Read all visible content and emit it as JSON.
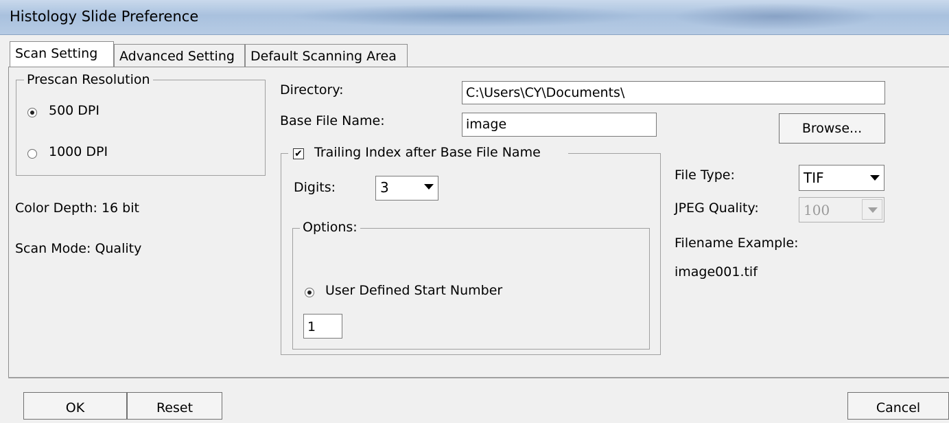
{
  "window": {
    "title": "Histology Slide Preference"
  },
  "tabs": [
    {
      "label": "Scan Setting",
      "active": true
    },
    {
      "label": "Advanced Setting",
      "active": false
    },
    {
      "label": "Default Scanning Area",
      "active": false
    }
  ],
  "prescan": {
    "legend": "Prescan Resolution",
    "options": [
      {
        "label": "500 DPI",
        "selected": true
      },
      {
        "label": "1000 DPI",
        "selected": false
      }
    ]
  },
  "info": {
    "color_depth": "Color Depth: 16 bit",
    "scan_mode": "Scan Mode: Quality"
  },
  "directory": {
    "label": "Directory:",
    "value": "C:\\Users\\CY\\Documents\\"
  },
  "base_file": {
    "label": "Base File Name:",
    "value": "image"
  },
  "browse_label": "Browse...",
  "trailing": {
    "label": "Trailing Index after Base File Name",
    "checked": true,
    "digits_label": "Digits:",
    "digits_value": "3",
    "options_legend": "Options:",
    "user_defined_label": "User Defined Start Number",
    "user_defined_selected": true,
    "start_number": "1"
  },
  "file_type": {
    "label": "File Type:",
    "value": "TIF"
  },
  "jpeg_quality": {
    "label": "JPEG Quality:",
    "value": "100",
    "enabled": false
  },
  "filename_example": {
    "label": "Filename Example:",
    "value": "image001.tif"
  },
  "buttons": {
    "ok": "OK",
    "reset": "Reset",
    "cancel": "Cancel"
  }
}
